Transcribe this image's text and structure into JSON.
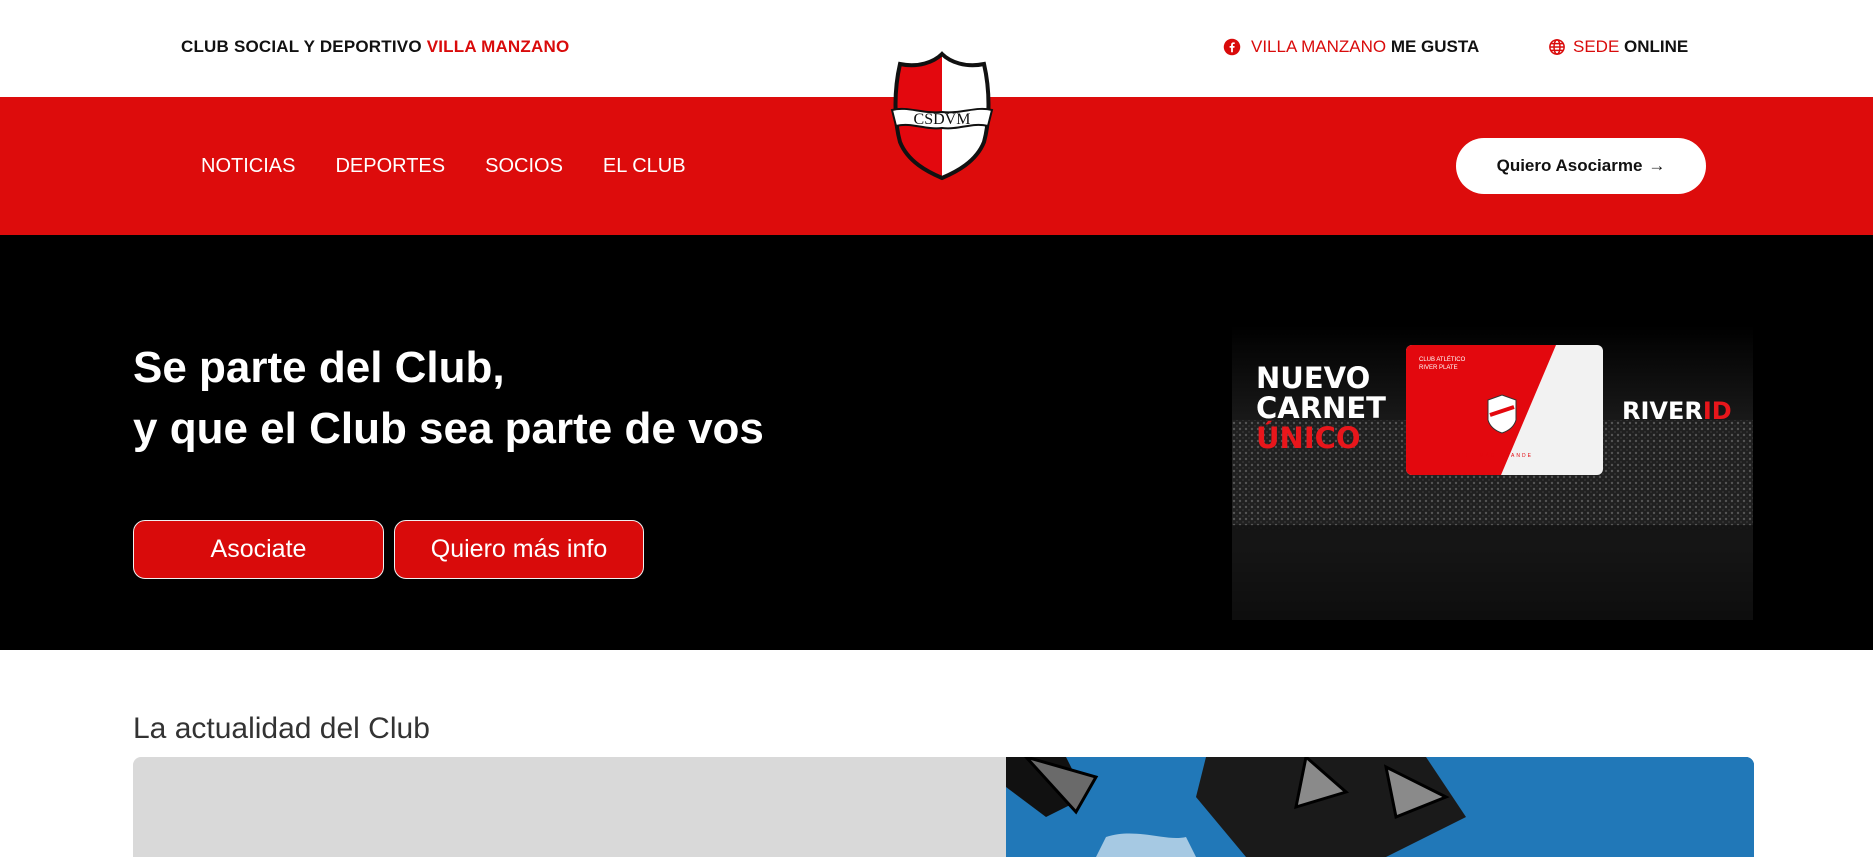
{
  "topbar": {
    "club_prefix": "CLUB SOCIAL Y DEPORTIVO ",
    "club_highlight": "VILLA MANZANO",
    "fb_highlight": "VILLA MANZANO",
    "fb_bold": " ME GUSTA",
    "sede_highlight": "SEDE",
    "sede_bold": " ONLINE"
  },
  "logo": {
    "text": "CSDVM"
  },
  "nav": {
    "items": [
      {
        "label": "NOTICIAS"
      },
      {
        "label": "DEPORTES"
      },
      {
        "label": "SOCIOS"
      },
      {
        "label": "EL CLUB"
      }
    ],
    "cta_label": "Quiero Asociarme",
    "cta_arrow": "→"
  },
  "hero": {
    "title_line1": "Se parte del Club,",
    "title_line2": "y que el Club sea parte de vos",
    "btn_primary": "Asociate",
    "btn_secondary": "Quiero más info"
  },
  "promo": {
    "line1": "NUEVO",
    "line2": "CARNET",
    "line3": "ÚNICO",
    "brand_white": "RIVER",
    "brand_red": "ID",
    "card_line1": "CLUB ATLÉTICO",
    "card_line2": "RIVER PLATE",
    "card_footer": "EL MÁS GRANDE"
  },
  "news": {
    "heading": "La actualidad del Club"
  },
  "colors": {
    "brand_red": "#dd0c0c",
    "hero_bg": "#000000",
    "white": "#ffffff"
  },
  "icons": {
    "facebook": "facebook-icon",
    "globe": "globe-icon",
    "arrow": "arrow-right-icon"
  }
}
